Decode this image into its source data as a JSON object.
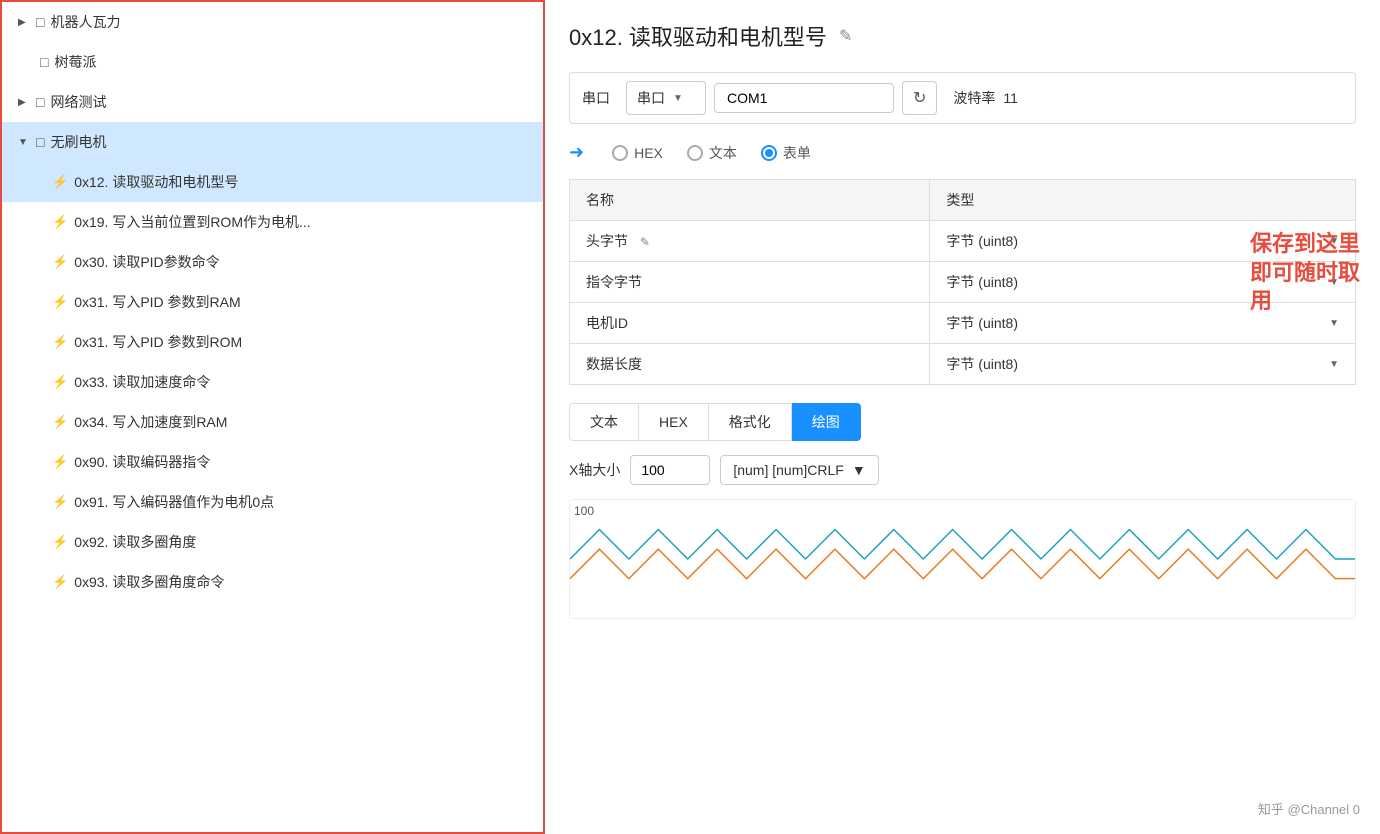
{
  "sidebar": {
    "items": [
      {
        "id": "jiqiren",
        "label": "机器人瓦力",
        "level": 1,
        "type": "folder",
        "expanded": false,
        "hasArrow": true
      },
      {
        "id": "shumopai",
        "label": "树莓派",
        "level": 1,
        "type": "folder",
        "expanded": false,
        "hasArrow": false
      },
      {
        "id": "wangluoceshi",
        "label": "网络测试",
        "level": 1,
        "type": "folder",
        "expanded": false,
        "hasArrow": true
      },
      {
        "id": "wushuadianj",
        "label": "无刷电机",
        "level": 1,
        "type": "folder",
        "expanded": true,
        "hasArrow": true
      },
      {
        "id": "cmd0x12",
        "label": "0x12. 读取驱动和电机型号",
        "level": 2,
        "type": "cmd",
        "active": true
      },
      {
        "id": "cmd0x19",
        "label": "0x19. 写入当前位置到ROM作为电机...",
        "level": 2,
        "type": "cmd"
      },
      {
        "id": "cmd0x30",
        "label": "0x30. 读取PID参数命令",
        "level": 2,
        "type": "cmd"
      },
      {
        "id": "cmd0x31a",
        "label": "0x31. 写入PID 参数到RAM",
        "level": 2,
        "type": "cmd"
      },
      {
        "id": "cmd0x31b",
        "label": "0x31. 写入PID 参数到ROM",
        "level": 2,
        "type": "cmd"
      },
      {
        "id": "cmd0x33",
        "label": "0x33. 读取加速度命令",
        "level": 2,
        "type": "cmd"
      },
      {
        "id": "cmd0x34",
        "label": "0x34. 写入加速度到RAM",
        "level": 2,
        "type": "cmd"
      },
      {
        "id": "cmd0x90",
        "label": "0x90. 读取编码器指令",
        "level": 2,
        "type": "cmd"
      },
      {
        "id": "cmd0x91",
        "label": "0x91. 写入编码器值作为电机0点",
        "level": 2,
        "type": "cmd"
      },
      {
        "id": "cmd0x92",
        "label": "0x92. 读取多圈角度",
        "level": 2,
        "type": "cmd"
      },
      {
        "id": "cmd0x93",
        "label": "0x93. 读取多圈角度命令",
        "level": 2,
        "type": "cmd"
      }
    ]
  },
  "content": {
    "title": "0x12. 读取驱动和电机型号",
    "serial": {
      "label": "串口",
      "com_value": "COM1",
      "baud_label": "波特率",
      "baud_value": "11"
    },
    "format_tabs": [
      {
        "id": "hex",
        "label": "HEX",
        "selected": false
      },
      {
        "id": "text",
        "label": "文本",
        "selected": false
      },
      {
        "id": "form",
        "label": "表单",
        "selected": true
      }
    ],
    "table": {
      "headers": [
        "名称",
        "类型"
      ],
      "rows": [
        {
          "name": "头字节",
          "type": "字节 (uint8)",
          "has_pencil": true
        },
        {
          "name": "指令字节",
          "type": "字节 (uint8)",
          "has_pencil": false
        },
        {
          "name": "电机ID",
          "type": "字节 (uint8)",
          "has_pencil": false
        },
        {
          "name": "数据长度",
          "type": "字节 (uint8)",
          "has_pencil": false
        }
      ]
    },
    "output_tabs": [
      {
        "id": "text",
        "label": "文本",
        "active": false
      },
      {
        "id": "hex",
        "label": "HEX",
        "active": false
      },
      {
        "id": "format",
        "label": "格式化",
        "active": false
      },
      {
        "id": "chart",
        "label": "绘图",
        "active": true
      }
    ],
    "xaxis": {
      "label": "X轴大小",
      "value": "100",
      "format_value": "[num] [num]CRLF"
    },
    "chart": {
      "y_label": "100",
      "channel_label": "Channel 0"
    },
    "annotation": "保存到这里\n即可随时取\n用",
    "watermark": "知乎 @Channel 0"
  }
}
